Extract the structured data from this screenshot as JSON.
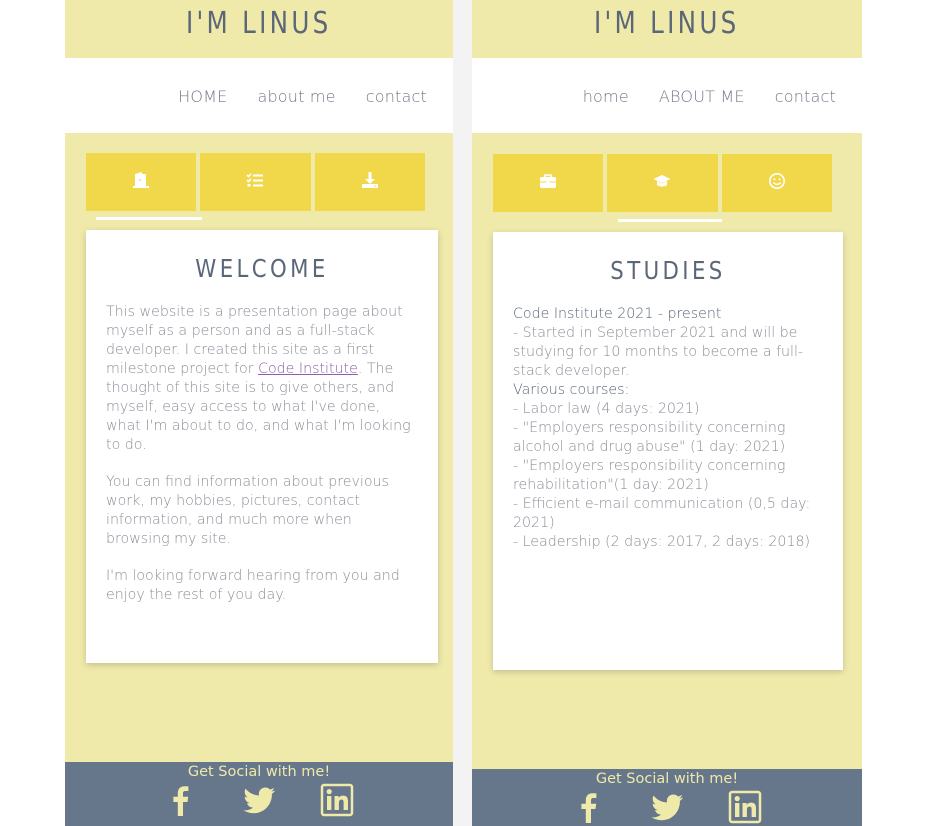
{
  "colors": {
    "page_bg": "#efeaaa",
    "tab_bg": "#f1d84b",
    "footer_bg": "#66768b",
    "title_color": "#5b6778",
    "text_color": "#8a8f98",
    "link_color": "#8e5ea8"
  },
  "left": {
    "site_title": "I'M LINUS",
    "nav": [
      "HOME",
      "about me",
      "contact"
    ],
    "tabs": [
      {
        "icon": "door-open-icon"
      },
      {
        "icon": "list-check-icon"
      },
      {
        "icon": "download-icon"
      }
    ],
    "card_title": "WELCOME",
    "para1_before": "This website is a presentation page about myself as a person and as a full-stack developer. I created this site as a first milestone project for ",
    "para1_link": "Code Institute",
    "para1_after": ". The thought of this site is to give others, and myself, easy access to what I've done, what I'm about to do, and what I'm looking to do.",
    "para2": "You can find information about previous work, my hobbies, pictures, contact information, and much more when browsing my site.",
    "para3": "I'm looking forward hearing from you and enjoy the rest of you day.",
    "footer_text": "Get Social with me!",
    "socials": [
      "facebook-icon",
      "twitter-icon",
      "linkedin-icon"
    ]
  },
  "right": {
    "site_title": "I'M LINUS",
    "nav": [
      "home",
      "ABOUT ME",
      "contact"
    ],
    "tabs": [
      {
        "icon": "briefcase-icon"
      },
      {
        "icon": "graduation-cap-icon"
      },
      {
        "icon": "smile-icon"
      }
    ],
    "card_title": "STUDIES",
    "study_heading": "Code Institute 2021 - present",
    "study_desc": "- Started in September 2021 and will be studying for 10 months to become a full-stack developer.",
    "courses_heading": "Various courses:",
    "courses": [
      "- Labor law (4 days: 2021)",
      "- \"Employers responsibility concerning alcohol and drug abuse\" (1 day: 2021)",
      "- \"Employers responsibility concerning rehabilitation\"(1 day: 2021)",
      "- Efficient e-mail communication (0,5 day: 2021)",
      "- Leadership (2 days: 2017, 2 days: 2018)"
    ],
    "footer_text": "Get Social with me!",
    "socials": [
      "facebook-icon",
      "twitter-icon",
      "linkedin-icon"
    ]
  }
}
